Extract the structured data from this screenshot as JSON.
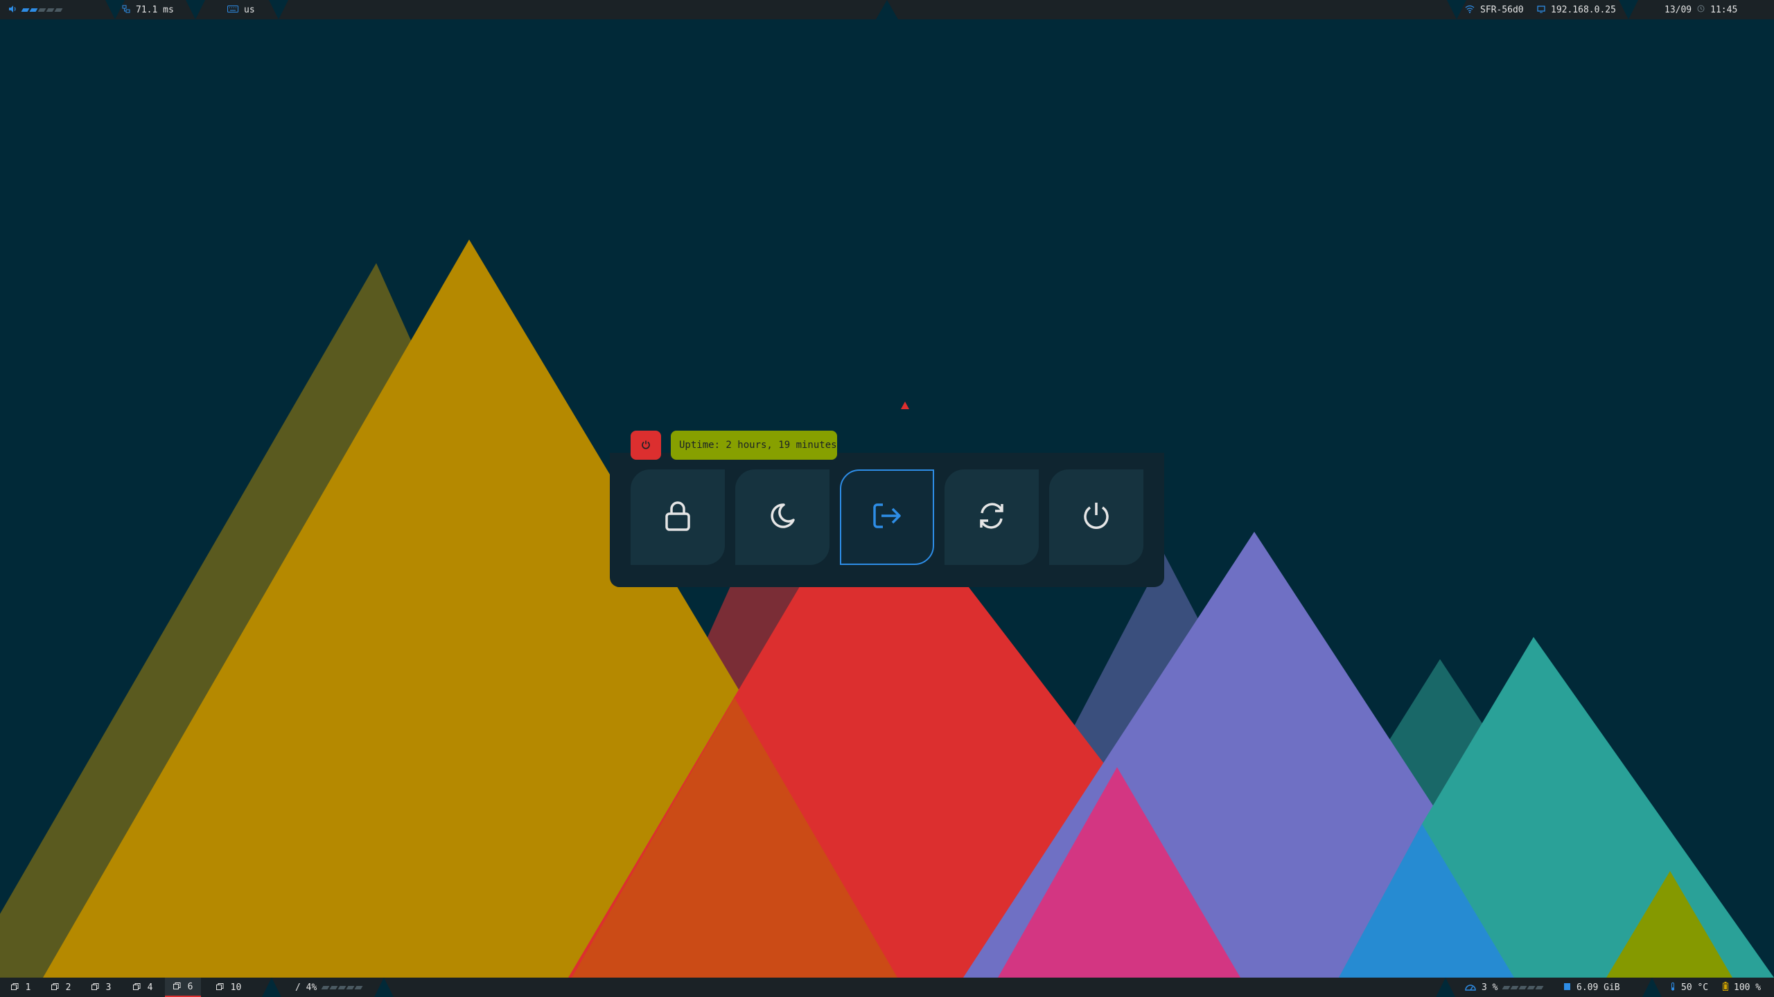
{
  "top_bar": {
    "volume": {
      "icon": "speaker-icon",
      "level_segments": 5,
      "filled": 2
    },
    "ping": {
      "icon": "network-icon",
      "value": "71.1 ms"
    },
    "keyboard": {
      "icon": "keyboard-icon",
      "layout": "us"
    },
    "wifi": {
      "icon": "wifi-icon",
      "ssid": "SFR-56d0"
    },
    "ip": {
      "icon": "ethernet-icon",
      "address": "192.168.0.25"
    },
    "date": "13/09",
    "time": {
      "icon": "clock-icon",
      "value": "11:45"
    }
  },
  "bottom_bar": {
    "workspaces": [
      {
        "label": "1",
        "icon": "window-icon",
        "active": false
      },
      {
        "label": "2",
        "icon": "window-icon",
        "active": false
      },
      {
        "label": "3",
        "icon": "window-icon",
        "active": false
      },
      {
        "label": "4",
        "icon": "window-icon",
        "active": false
      },
      {
        "label": "6",
        "icon": "window-icon",
        "active": true
      },
      {
        "label": "10",
        "icon": "window-icon",
        "active": false
      }
    ],
    "disk": {
      "label": "/ 4%",
      "level_segments": 5,
      "filled": 0
    },
    "cpu": {
      "icon": "cpu-icon",
      "value": "3 %",
      "level_segments": 5,
      "filled": 0
    },
    "memory": {
      "icon": "memory-icon",
      "value": "6.09 GiB"
    },
    "temperature": {
      "icon": "thermometer-icon",
      "value": "50 °C"
    },
    "battery": {
      "icon": "battery-icon",
      "value": "100 %"
    }
  },
  "power_menu": {
    "badge_icon": "power-icon",
    "uptime": "Uptime: 2 hours, 19 minutes",
    "buttons": [
      {
        "name": "lock",
        "icon": "lock-icon",
        "selected": false
      },
      {
        "name": "suspend",
        "icon": "moon-icon",
        "selected": false
      },
      {
        "name": "logout",
        "icon": "logout-icon",
        "selected": true
      },
      {
        "name": "reboot",
        "icon": "reboot-icon",
        "selected": false
      },
      {
        "name": "shutdown",
        "icon": "power-icon",
        "selected": false
      }
    ]
  },
  "colors": {
    "background": "#012938",
    "accent_blue": "#2e8de6",
    "accent_red": "#dc2f2f",
    "accent_green": "#87a000",
    "bar_bg": "#1b2226"
  }
}
